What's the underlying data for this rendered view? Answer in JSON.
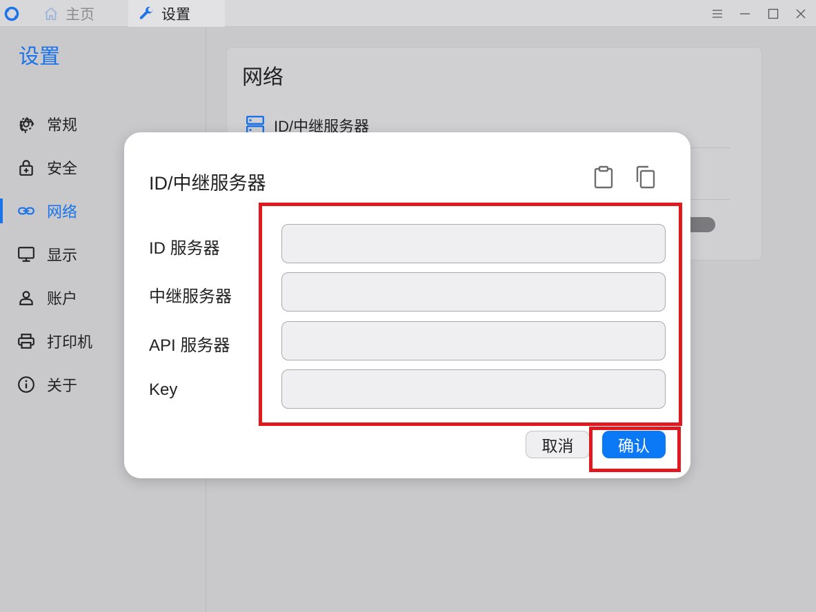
{
  "titlebar": {
    "tabs": [
      {
        "label": "主页",
        "icon": "home-icon"
      },
      {
        "label": "设置",
        "icon": "wrench-icon"
      }
    ],
    "controls": [
      "menu-icon",
      "minimize-icon",
      "maximize-icon",
      "close-icon"
    ]
  },
  "sidebar": {
    "title": "设置",
    "items": [
      {
        "label": "常规",
        "icon": "gear-icon"
      },
      {
        "label": "安全",
        "icon": "lock-icon"
      },
      {
        "label": "网络",
        "icon": "link-icon",
        "active": true
      },
      {
        "label": "显示",
        "icon": "monitor-icon"
      },
      {
        "label": "账户",
        "icon": "person-icon"
      },
      {
        "label": "打印机",
        "icon": "printer-icon"
      },
      {
        "label": "关于",
        "icon": "info-icon"
      }
    ]
  },
  "main": {
    "card_title": "网络",
    "row_label": "ID/中继服务器"
  },
  "dialog": {
    "title": "ID/中继服务器",
    "fields": [
      {
        "label": "ID 服务器",
        "value": ""
      },
      {
        "label": "中继服务器",
        "value": ""
      },
      {
        "label": "API 服务器",
        "value": ""
      },
      {
        "label": "Key",
        "value": ""
      }
    ],
    "cancel_label": "取消",
    "ok_label": "确认"
  },
  "colors": {
    "accent": "#1a73e8",
    "button_primary": "#0b78f5",
    "highlight": "#e0191e"
  }
}
